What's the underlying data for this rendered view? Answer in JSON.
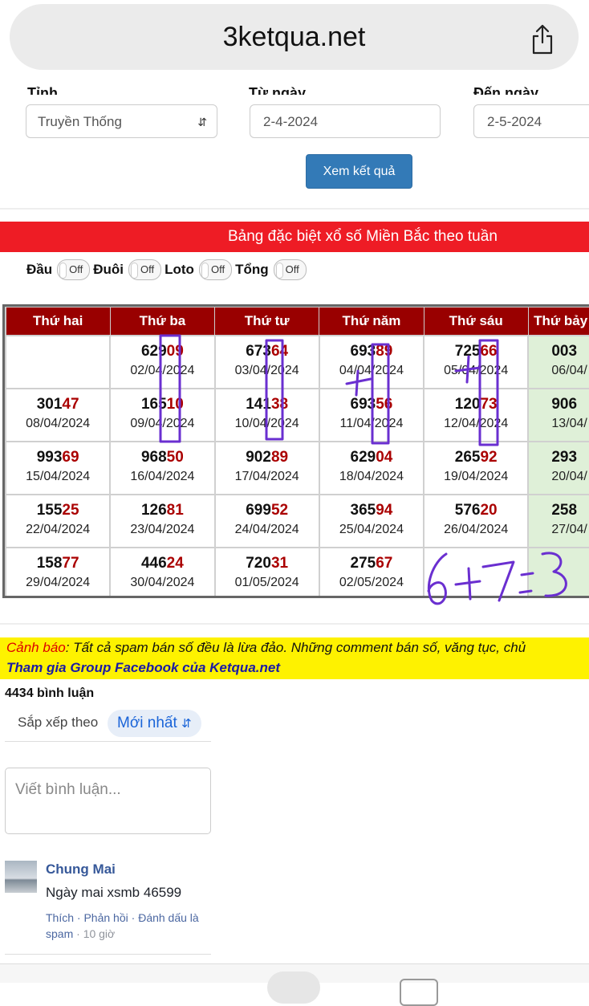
{
  "browser": {
    "url": "3ketqua.net",
    "share_icon": "share-icon"
  },
  "filter": {
    "province_label": "Tỉnh",
    "from_label": "Từ ngày",
    "to_label": "Đến ngày",
    "province_value": "Truyền Thống",
    "from_value": "2-4-2024",
    "to_value": "2-5-2024",
    "submit_label": "Xem kết quả"
  },
  "banner": "Bảng đặc biệt xổ số Miền Bắc theo tuần",
  "toggles": [
    {
      "label": "Đầu",
      "state": "Off"
    },
    {
      "label": "Đuôi",
      "state": "Off"
    },
    {
      "label": "Loto",
      "state": "Off"
    },
    {
      "label": "Tổng",
      "state": "Off"
    }
  ],
  "table": {
    "headers": [
      "Thứ hai",
      "Thứ ba",
      "Thứ tư",
      "Thứ năm",
      "Thứ sáu",
      "Thứ bảy"
    ],
    "rows": [
      [
        null,
        {
          "n": "629",
          "t": "09",
          "d": "02/04/2024"
        },
        {
          "n": "673",
          "t": "64",
          "d": "03/04/2024"
        },
        {
          "n": "693",
          "t": "89",
          "d": "04/04/2024"
        },
        {
          "n": "725",
          "t": "66",
          "d": "05/04/2024"
        },
        {
          "n": "003",
          "t": "",
          "d": "06/04/"
        }
      ],
      [
        {
          "n": "301",
          "t": "47",
          "d": "08/04/2024"
        },
        {
          "n": "165",
          "t": "10",
          "d": "09/04/2024"
        },
        {
          "n": "141",
          "t": "38",
          "d": "10/04/2024"
        },
        {
          "n": "693",
          "t": "56",
          "d": "11/04/2024"
        },
        {
          "n": "120",
          "t": "73",
          "d": "12/04/2024"
        },
        {
          "n": "906",
          "t": "",
          "d": "13/04/"
        }
      ],
      [
        {
          "n": "993",
          "t": "69",
          "d": "15/04/2024"
        },
        {
          "n": "968",
          "t": "50",
          "d": "16/04/2024"
        },
        {
          "n": "902",
          "t": "89",
          "d": "17/04/2024"
        },
        {
          "n": "629",
          "t": "04",
          "d": "18/04/2024"
        },
        {
          "n": "265",
          "t": "92",
          "d": "19/04/2024"
        },
        {
          "n": "293",
          "t": "",
          "d": "20/04/"
        }
      ],
      [
        {
          "n": "155",
          "t": "25",
          "d": "22/04/2024"
        },
        {
          "n": "126",
          "t": "81",
          "d": "23/04/2024"
        },
        {
          "n": "699",
          "t": "52",
          "d": "24/04/2024"
        },
        {
          "n": "365",
          "t": "94",
          "d": "25/04/2024"
        },
        {
          "n": "576",
          "t": "20",
          "d": "26/04/2024"
        },
        {
          "n": "258",
          "t": "",
          "d": "27/04/"
        }
      ],
      [
        {
          "n": "158",
          "t": "77",
          "d": "29/04/2024"
        },
        {
          "n": "446",
          "t": "24",
          "d": "30/04/2024"
        },
        {
          "n": "720",
          "t": "31",
          "d": "01/05/2024"
        },
        {
          "n": "275",
          "t": "67",
          "d": "02/05/2024"
        },
        null,
        null
      ]
    ]
  },
  "handwriting": "6+7=3",
  "warning": {
    "prefix": "Cảnh báo",
    "text": ": Tất cả spam bán số đều là lừa đảo. Những comment bán số, văng tục, chủ",
    "link": "Tham gia Group Facebook của Ketqua.net"
  },
  "comments": {
    "count_label": "4434 bình luận",
    "sort_label": "Sắp xếp theo",
    "sort_value": "Mới nhất",
    "placeholder": "Viết bình luận...",
    "items": [
      {
        "author": "Chung Mai",
        "text": "Ngày mai xsmb 46599",
        "like": "Thích",
        "reply": "Phản hồi",
        "spam": "Đánh dấu là spam",
        "time": "10 giờ"
      }
    ]
  }
}
